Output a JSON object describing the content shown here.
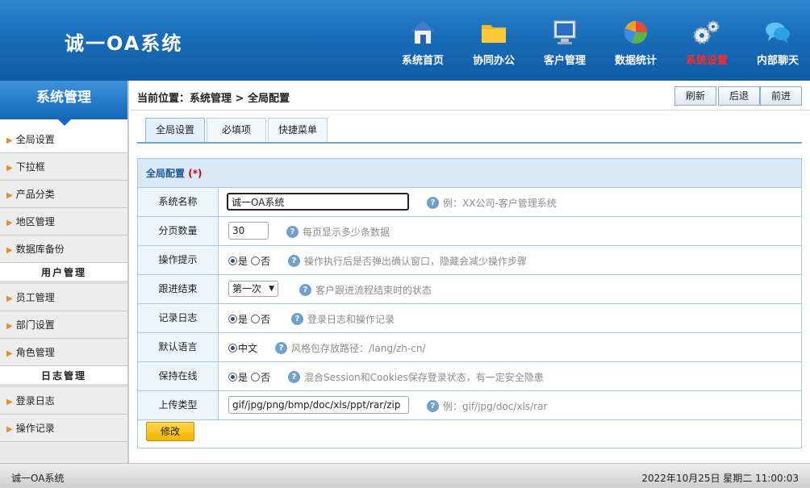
{
  "app": {
    "title": "诚一OA系统"
  },
  "topnav": [
    {
      "label": "系统首页",
      "icon": "house-icon",
      "active": false
    },
    {
      "label": "协同办公",
      "icon": "folder-icon",
      "active": false
    },
    {
      "label": "客户管理",
      "icon": "monitor-icon",
      "active": false
    },
    {
      "label": "数据统计",
      "icon": "pie-chart-icon",
      "active": false
    },
    {
      "label": "系统设置",
      "icon": "gears-icon",
      "active": true
    },
    {
      "label": "内部聊天",
      "icon": "chat-icon",
      "active": false
    }
  ],
  "sidebar": {
    "title": "系统管理",
    "items": [
      {
        "label": "全局设置",
        "active": true
      },
      {
        "label": "下拉框"
      },
      {
        "label": "产品分类"
      },
      {
        "label": "地区管理"
      },
      {
        "label": "数据库备份"
      }
    ],
    "group_user": "用户管理",
    "user_items": [
      {
        "label": "员工管理"
      },
      {
        "label": "部门设置"
      },
      {
        "label": "角色管理"
      }
    ],
    "group_log": "日志管理",
    "log_items": [
      {
        "label": "登录日志"
      },
      {
        "label": "操作记录"
      }
    ]
  },
  "breadcrumb": "当前位置：系统管理 > 全局配置",
  "toolbar": {
    "refresh": "刷新",
    "back": "后退",
    "forward": "前进"
  },
  "tabs": [
    "全局设置",
    "必填项",
    "快捷菜单"
  ],
  "panel": {
    "title": "全局配置",
    "required_mark": "(*)",
    "fields": {
      "system_name": {
        "label": "系统名称",
        "value": "诚一OA系统",
        "hint": "例：XX公司-客户管理系统"
      },
      "page_size": {
        "label": "分页数量",
        "value": "30",
        "hint": "每页显示多少条数据"
      },
      "op_prompt": {
        "label": "操作提示",
        "yes": "是",
        "no": "否",
        "selected": "是",
        "hint": "操作执行后是否弹出确认窗口，隐藏会减少操作步骤"
      },
      "follow_end": {
        "label": "跟进结束",
        "selected": "第一次",
        "hint": "客户跟进流程结束时的状态"
      },
      "log_record": {
        "label": "记录日志",
        "yes": "是",
        "no": "否",
        "selected": "是",
        "hint": "登录日志和操作记录"
      },
      "language": {
        "label": "默认语言",
        "option": "中文",
        "hint": "风格包存放路径：/lang/zh-cn/"
      },
      "keep_online": {
        "label": "保持在线",
        "yes": "是",
        "no": "否",
        "selected": "是",
        "hint": "混合Session和Cookies保存登录状态，有一定安全隐患"
      },
      "upload_types": {
        "label": "上传类型",
        "value": "gif/jpg/png/bmp/doc/xls/ppt/rar/zip",
        "hint": "例：gif/jpg/doc/xls/rar"
      }
    },
    "save_label": "修改"
  },
  "footer": {
    "left": "诚一OA系统",
    "datetime": "2022年10月25日 星期二  11:00:03"
  },
  "colors": {
    "header_blue": "#1a6db9",
    "active_nav": "#ff2a2a",
    "save_button": "#f0b400"
  }
}
